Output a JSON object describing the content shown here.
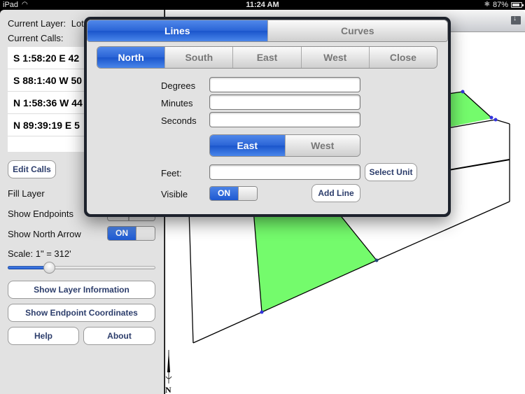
{
  "status_bar": {
    "device": "iPad",
    "time": "11:24 AM",
    "battery": "87%"
  },
  "left_panel": {
    "current_layer_label": "Current Layer:",
    "current_layer_value": "Lot",
    "current_calls_label": "Current Calls:",
    "calls": [
      "S 1:58:20 E 42",
      "S 88:1:40 W 50",
      "N 1:58:36 W 44",
      "N 89:39:19 E 5"
    ],
    "edit_calls_button": "Edit Calls",
    "fill_layer_label": "Fill Layer",
    "show_endpoints_label": "Show Endpoints",
    "show_north_arrow_label": "Show North Arrow",
    "show_north_arrow_state": "ON",
    "scale_label": "Scale: 1\" = 312'",
    "scale_slider_fraction": 0.28,
    "buttons": {
      "show_layer_info": "Show Layer Information",
      "show_endpoint_coords": "Show Endpoint Coordinates",
      "help": "Help",
      "about": "About"
    }
  },
  "popover": {
    "tabs": [
      {
        "label": "Lines",
        "selected": true
      },
      {
        "label": "Curves",
        "selected": false
      }
    ],
    "direction_segments": [
      {
        "label": "North",
        "selected": true
      },
      {
        "label": "South",
        "selected": false
      },
      {
        "label": "East",
        "selected": false
      },
      {
        "label": "West",
        "selected": false
      },
      {
        "label": "Close",
        "selected": false
      }
    ],
    "degrees_label": "Degrees",
    "degrees_value": "",
    "minutes_label": "Minutes",
    "minutes_value": "",
    "seconds_label": "Seconds",
    "seconds_value": "",
    "ew_segments": [
      {
        "label": "East",
        "selected": true
      },
      {
        "label": "West",
        "selected": false
      }
    ],
    "feet_label": "Feet:",
    "feet_value": "",
    "select_unit_button": "Select Unit",
    "visible_label": "Visible",
    "visible_state": "ON",
    "add_line_button": "Add Line"
  },
  "map": {
    "north_label": "N",
    "fill_color": "#74fb6c",
    "endpoint_color": "#3333dd"
  }
}
